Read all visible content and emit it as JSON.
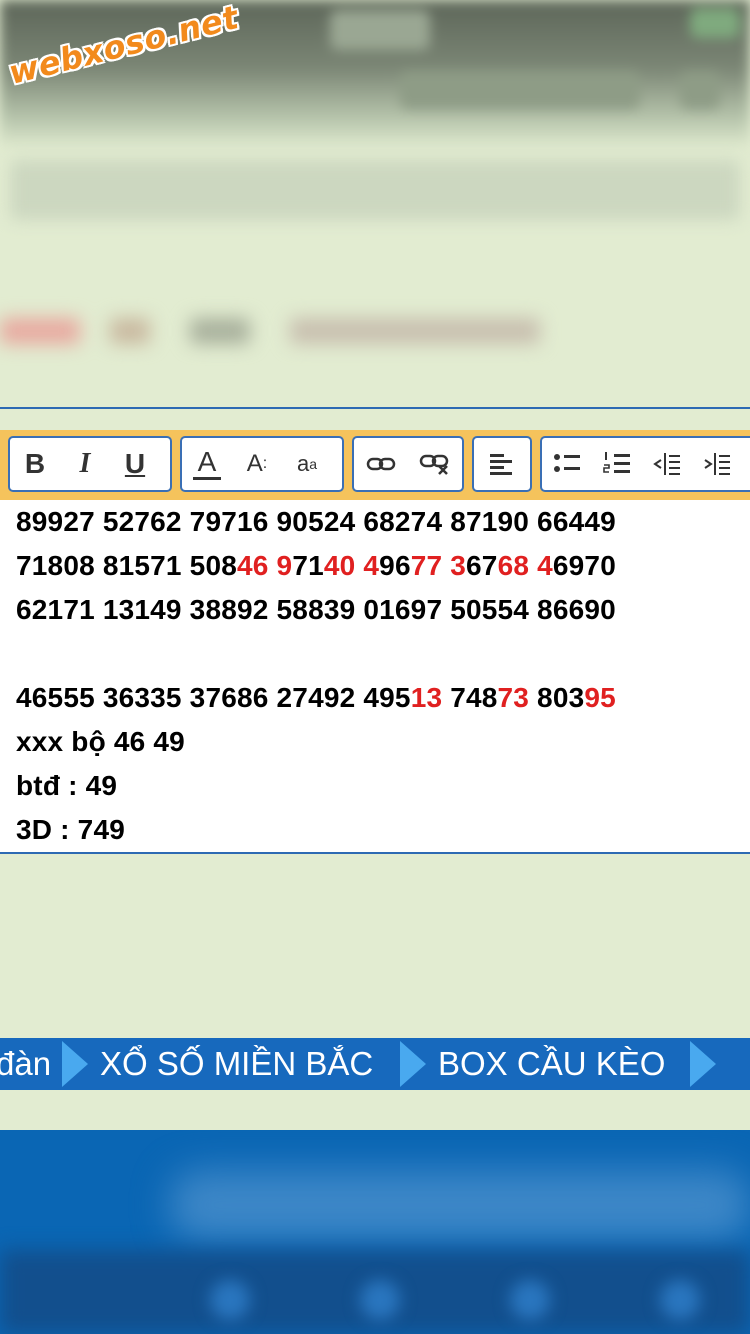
{
  "logo": {
    "text": "webxoso.net"
  },
  "toolbar": {
    "bold": "B",
    "italic": "I",
    "underline": "U",
    "font_color": "A",
    "font_size": "A",
    "font_case": "a"
  },
  "editor": {
    "lines": [
      [
        {
          "t": "89927 52762 79716 90524 68274 87190 66449",
          "r": false
        }
      ],
      [
        {
          "t": "71808 81571 508",
          "r": false
        },
        {
          "t": "46",
          "r": true
        },
        {
          "t": " ",
          "r": false
        },
        {
          "t": "9",
          "r": true
        },
        {
          "t": "71",
          "r": false
        },
        {
          "t": "40",
          "r": true
        },
        {
          "t": " ",
          "r": false
        },
        {
          "t": "4",
          "r": true
        },
        {
          "t": "96",
          "r": false
        },
        {
          "t": "77",
          "r": true
        },
        {
          "t": " ",
          "r": false
        },
        {
          "t": "3",
          "r": true
        },
        {
          "t": "67",
          "r": false
        },
        {
          "t": "68",
          "r": true
        },
        {
          "t": " ",
          "r": false
        },
        {
          "t": "4",
          "r": true
        },
        {
          "t": "6970",
          "r": false
        }
      ],
      [
        {
          "t": "62171 13149 38892 58839 01697 50554 86690",
          "r": false
        }
      ],
      [
        {
          "t": "",
          "r": false
        }
      ],
      [
        {
          "t": "46555 36335 37686 27492 495",
          "r": false
        },
        {
          "t": "13",
          "r": true
        },
        {
          "t": " 748",
          "r": false
        },
        {
          "t": "73",
          "r": true
        },
        {
          "t": " 803",
          "r": false
        },
        {
          "t": "95",
          "r": true
        }
      ],
      [
        {
          "t": "xxx bộ 46 49",
          "r": false
        }
      ],
      [
        {
          "t": "btđ : 49",
          "r": false
        }
      ],
      [
        {
          "t": "3D : 749",
          "r": false
        }
      ]
    ],
    "highlight_color": "#e02020"
  },
  "nav": {
    "items": [
      {
        "label": "đàn"
      },
      {
        "label": "XỔ SỐ MIỀN BẮC"
      },
      {
        "label": "BOX CẦU KÈO"
      }
    ],
    "bg_color": "#1769bd",
    "arrow_color": "#49a9ef"
  }
}
